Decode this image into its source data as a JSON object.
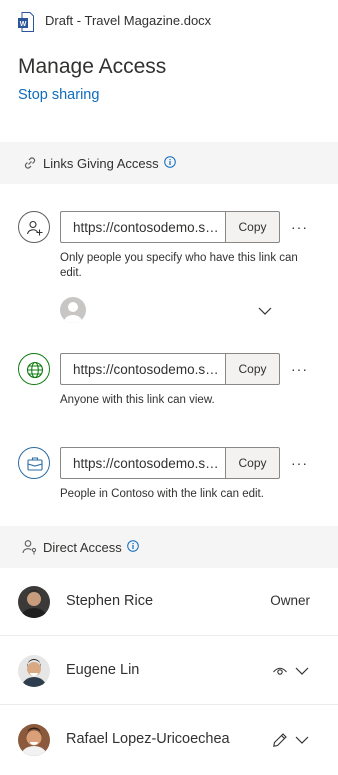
{
  "header": {
    "doc_title": "Draft - Travel Magazine.docx",
    "page_title": "Manage Access",
    "stop_sharing": "Stop sharing"
  },
  "links_section": {
    "label": "Links Giving Access",
    "links": [
      {
        "icon": "people-add-icon",
        "url": "https://contosodemo.sharepoint.com/:w:/s/travel",
        "copy_label": "Copy",
        "more_label": "···",
        "description": "Only people you specify who have this link can edit."
      },
      {
        "icon": "globe-icon",
        "url": "https://contosodemo.sharepoint.com/:w:/s/travel",
        "copy_label": "Copy",
        "more_label": "···",
        "description": "Anyone with this link can view."
      },
      {
        "icon": "organization-briefcase-icon",
        "url": "https://contosodemo.sharepoint.com/:w:/s/travel",
        "copy_label": "Copy",
        "more_label": "···",
        "description": "People in Contoso with the link can edit."
      }
    ]
  },
  "direct_section": {
    "label": "Direct Access",
    "people": [
      {
        "name": "Stephen Rice",
        "role": "Owner",
        "permission_icon": ""
      },
      {
        "name": "Eugene Lin",
        "role": "",
        "permission_icon": "eye-icon"
      },
      {
        "name": "Rafael Lopez-Uricoechea",
        "role": "",
        "permission_icon": "pencil-icon"
      }
    ]
  },
  "colors": {
    "accent": "#0f6cbd",
    "section_background": "#f5f5f5",
    "globe_green": "#107c10",
    "org_blue": "#2b6ca3",
    "word_blue": "#2b579a"
  }
}
